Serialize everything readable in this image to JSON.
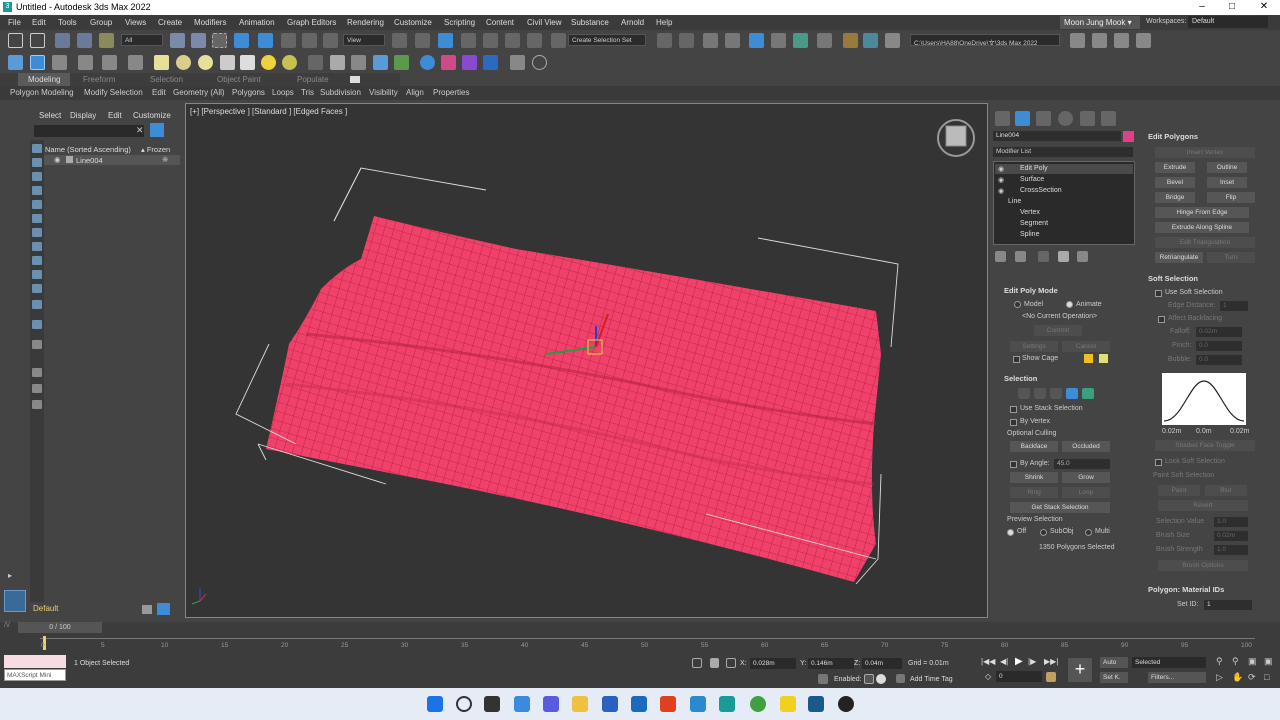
{
  "window": {
    "title": "Untitled - Autodesk 3ds Max 2022"
  },
  "menu": [
    "File",
    "Edit",
    "Tools",
    "Group",
    "Views",
    "Create",
    "Modifiers",
    "Animation",
    "Graph Editors",
    "Rendering",
    "Customize",
    "Scripting",
    "Content",
    "Civil View",
    "Substance",
    "Arnold",
    "Help"
  ],
  "user": {
    "name": "Moon Jung Mook ▾",
    "workspaces_label": "Workspaces:",
    "workspace": "Default"
  },
  "toolbar": {
    "filter": "All",
    "refcoord": "View",
    "selection_set": "Create Selection Set",
    "project_path": "C:\\Users\\HA88\\OneDrive\\文\\3ds Max 2022"
  },
  "ribbon": {
    "tabs": [
      "Modeling",
      "Freeform",
      "Selection",
      "Object Paint",
      "Populate"
    ],
    "items": [
      "Polygon Modeling",
      "Modify Selection",
      "Edit",
      "Geometry (All)",
      "Polygons",
      "Loops",
      "Tris",
      "Subdivision",
      "Visibility",
      "Align",
      "Properties"
    ]
  },
  "scene_explorer": {
    "tabs": [
      "Select",
      "Display",
      "Edit",
      "Customize"
    ],
    "col_name": "Name (Sorted Ascending)",
    "col_frozen": "▴ Frozen",
    "objects": [
      "Line004"
    ]
  },
  "layer": {
    "name": "Default"
  },
  "viewport": {
    "label": "[+] [Perspective ] [Standard ] [Edged Faces ]"
  },
  "command_panel": {
    "object_name": "Line004",
    "object_color": "#e0408a",
    "modifier_list": "Modifier List",
    "stack": [
      "Edit Poly",
      "Surface",
      "CrossSection",
      "Line",
      "Vertex",
      "Segment",
      "Spline"
    ],
    "edit_poly_mode": {
      "title": "Edit Poly Mode",
      "model": "Model",
      "animate": "Animate",
      "op": "<No Current Operation>",
      "commit": "Commit",
      "settings": "Settings",
      "cancel": "Cancel",
      "show_cage": "Show Cage"
    },
    "selection": {
      "title": "Selection",
      "use_stack": "Use Stack Selection",
      "by_vertex": "By Vertex",
      "culling": "Optional Culling",
      "backface": "Backface",
      "occluded": "Occluded",
      "by_angle": "By Angle:",
      "angle": "45.0",
      "shrink": "Shrink",
      "grow": "Grow",
      "ring": "Ring",
      "loop": "Loop",
      "get_stack": "Get Stack Selection",
      "preview": "Preview Selection",
      "off": "Off",
      "subobj": "SubObj",
      "multi": "Multi",
      "status": "1350 Polygons Selected"
    },
    "edit_polygons": {
      "title": "Edit Polygons",
      "insert_vertex": "Insert Vertex",
      "extrude": "Extrude",
      "outline": "Outline",
      "bevel": "Bevel",
      "inset": "Inset",
      "bridge": "Bridge",
      "flip": "Flip",
      "hinge": "Hinge From Edge",
      "extrude_spline": "Extrude Along Spline",
      "edit_tri": "Edit Triangulation",
      "retriangulate": "Retriangulate",
      "turn": "Turn"
    },
    "soft_selection": {
      "title": "Soft Selection",
      "use": "Use Soft Selection",
      "edge_distance": "Edge Distance:",
      "edge_value": "1",
      "affect_backfacing": "Affect Backfacing",
      "falloff": "Falloff:",
      "falloff_value": "0.02m",
      "pinch": "Pinch:",
      "pinch_value": "0.0",
      "bubble": "Bubble:",
      "bubble_value": "0.0",
      "curve_left": "0.02m",
      "curve_mid": "0.0m",
      "curve_right": "0.02m",
      "shaded_face": "Shaded Face Toggle",
      "lock": "Lock Soft Selection",
      "paint_title": "Paint Soft Selection",
      "paint": "Paint",
      "blur": "Blur",
      "revert": "Revert",
      "sel_value": "Selection Value",
      "sel_value_v": "1.0",
      "brush_size": "Brush Size",
      "brush_size_v": "0.02m",
      "brush_strength": "Brush Strength",
      "brush_strength_v": "1.0",
      "brush_options": "Brush Options"
    },
    "material_ids": {
      "title": "Polygon: Material IDs",
      "set_id": "Set ID:",
      "set_id_value": "1"
    }
  },
  "timeline": {
    "frame": "0 / 100",
    "ticks": [
      "0",
      "5",
      "10",
      "15",
      "20",
      "25",
      "30",
      "35",
      "40",
      "45",
      "50",
      "55",
      "60",
      "65",
      "70",
      "75",
      "80",
      "85",
      "90",
      "95",
      "100"
    ]
  },
  "status": {
    "maxscript": "MAXScript Mini",
    "selected": "1 Object Selected",
    "x_label": "X:",
    "x": "0.028m",
    "y_label": "Y:",
    "y": "0.146m",
    "z_label": "Z:",
    "z": "0.04m",
    "grid": "Grid = 0.01m",
    "enabled": "Enabled:",
    "add_time_tag": "Add Time Tag",
    "auto": "Auto",
    "selected_dd": "Selected",
    "setk": "Set K.",
    "filters": "Filters...",
    "frame_field": "0"
  }
}
